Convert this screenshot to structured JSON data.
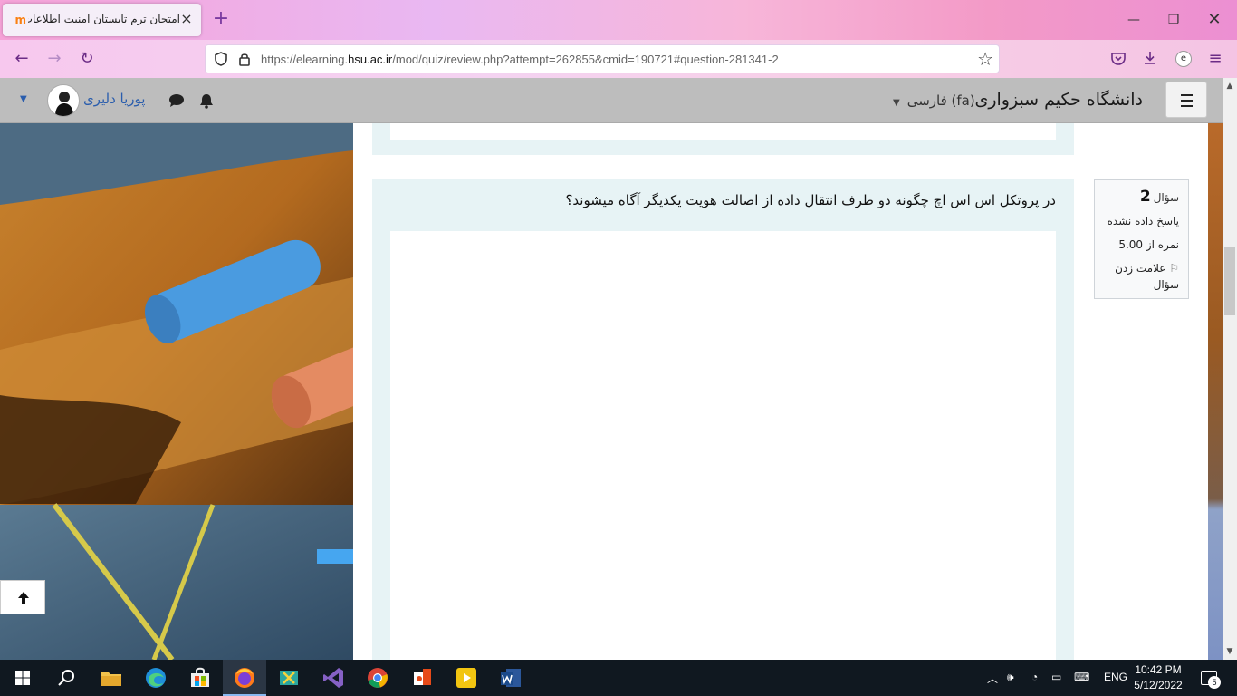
{
  "browser": {
    "tab_title": "امتحان ترم تابستان امنیت اطلاعات",
    "tab_favicon": "m",
    "url_prefix": "https://elearning.",
    "url_domain": "hsu.ac.ir",
    "url_suffix": "/mod/quiz/review.php?attempt=262855&cmid=190721#question-281341-2",
    "icons": [
      "back-icon",
      "forward-icon",
      "reload-icon",
      "shield-icon",
      "lock-icon",
      "star-icon",
      "pocket-icon",
      "download-icon",
      "extension-icon",
      "menu-icon"
    ]
  },
  "header": {
    "site_name": "دانشگاه حکیم سبزواری",
    "language": "فارسی ‎(fa)‎",
    "user_name": "پوریا دلیری"
  },
  "question": {
    "number_label": "سؤال",
    "number": "2",
    "state": "پاسخ داده نشده",
    "grade": "نمره از 5.00",
    "flag_label": "علامت زدن سؤال",
    "text": "در پروتکل اس اس اچ چگونه دو طرف انتقال داده از اصالت هویت یکدیگر آگاه میشوند؟"
  },
  "taskbar": {
    "language": "ENG",
    "time": "10:42 PM",
    "date": "5/12/2022",
    "notifications": "5"
  },
  "colors": {
    "header_bg": "#bdbdbd",
    "question_bg": "#e7f3f5",
    "link_blue": "#2a5dad"
  }
}
